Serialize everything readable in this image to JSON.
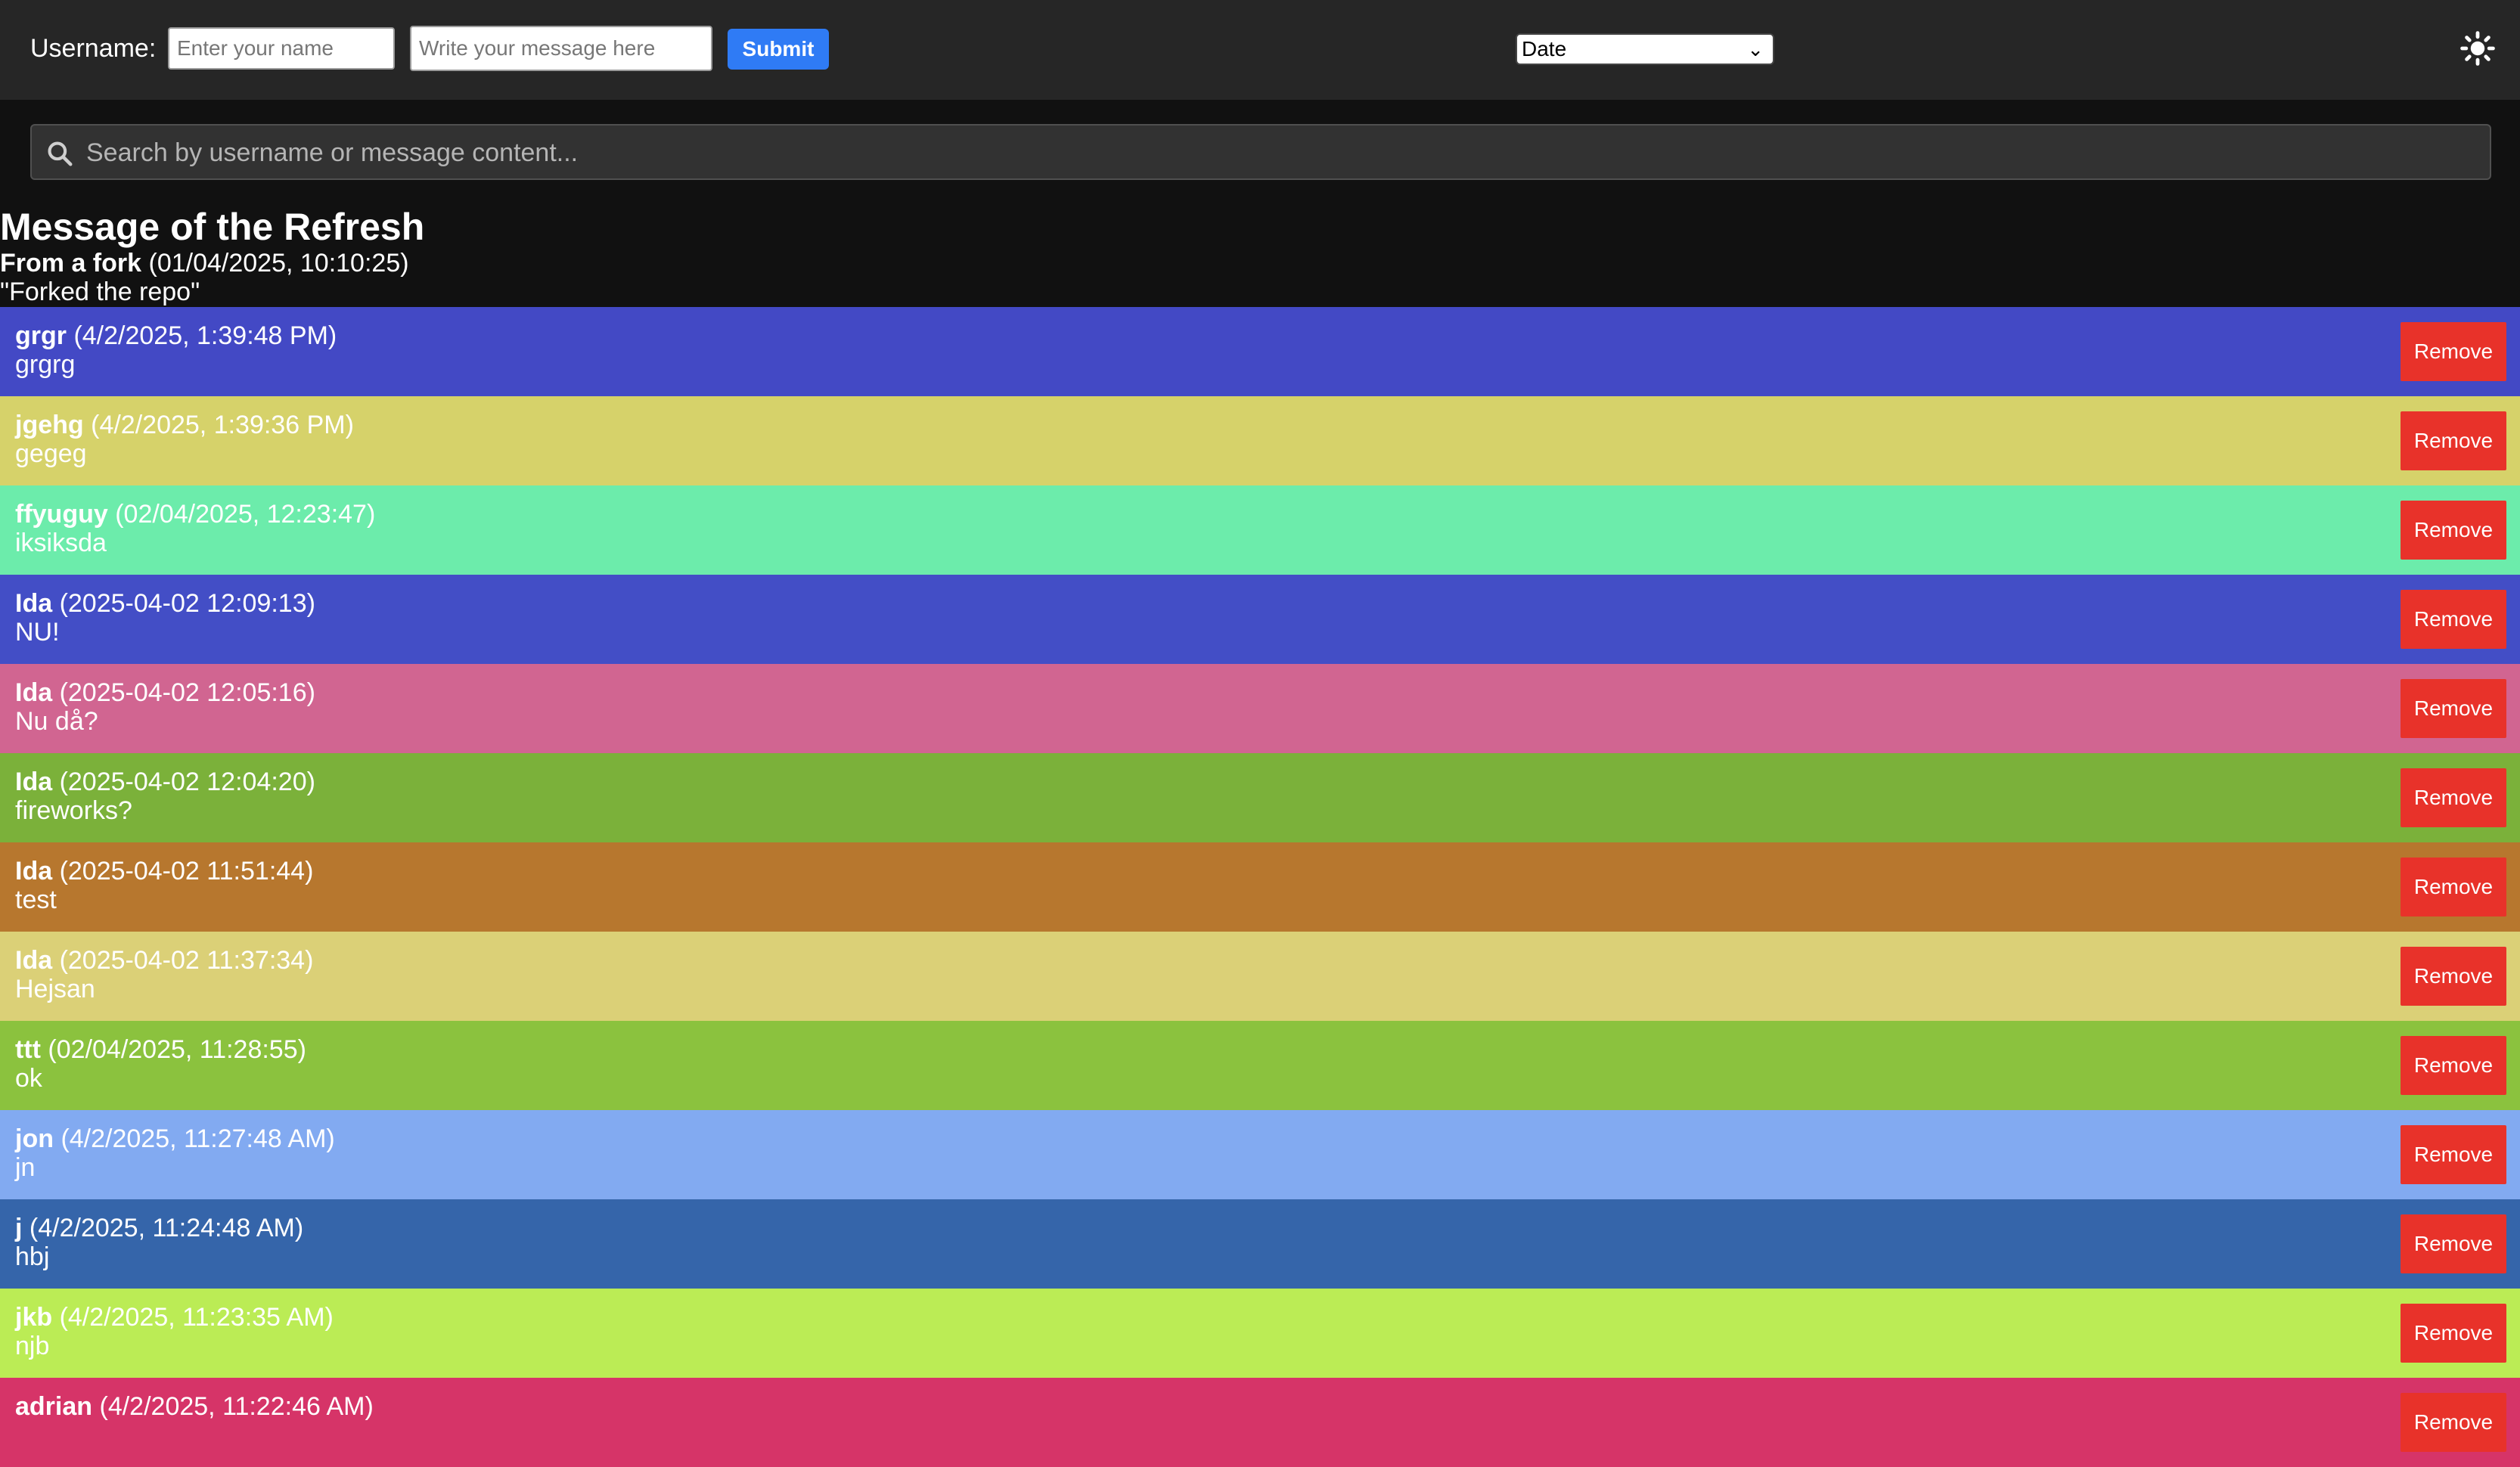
{
  "header": {
    "username_label": "Username:",
    "username_placeholder": "Enter your name",
    "message_placeholder": "Write your message here",
    "submit_label": "Submit",
    "sort_selected": "Date",
    "theme_icon": "sun-icon"
  },
  "search": {
    "placeholder": "Search by username or message content...",
    "icon": "search-icon"
  },
  "message_of_refresh": {
    "title": "Message of the Refresh",
    "author": "From a fork",
    "timestamp": "(01/04/2025, 10:10:25)",
    "text": "\"Forked the repo\""
  },
  "messages": [
    {
      "user": "grgr",
      "time": "(4/2/2025, 1:39:48 PM)",
      "text": "grgrg",
      "color": "#4349c5",
      "remove_label": "Remove"
    },
    {
      "user": "jgehg",
      "time": "(4/2/2025, 1:39:36 PM)",
      "text": "gegeg",
      "color": "#d6d26a",
      "remove_label": "Remove"
    },
    {
      "user": "ffyuguy",
      "time": "(02/04/2025, 12:23:47)",
      "text": "iksiksda",
      "color": "#6cecab",
      "remove_label": "Remove"
    },
    {
      "user": "Ida",
      "time": "(2025-04-02 12:09:13)",
      "text": "NU!",
      "color": "#434ec6",
      "remove_label": "Remove"
    },
    {
      "user": "Ida",
      "time": "(2025-04-02 12:05:16)",
      "text": "Nu då?",
      "color": "#d16591",
      "remove_label": "Remove"
    },
    {
      "user": "Ida",
      "time": "(2025-04-02 12:04:20)",
      "text": "fireworks?",
      "color": "#7bb13a",
      "remove_label": "Remove"
    },
    {
      "user": "Ida",
      "time": "(2025-04-02 11:51:44)",
      "text": "test",
      "color": "#b7772e",
      "remove_label": "Remove"
    },
    {
      "user": "Ida",
      "time": "(2025-04-02 11:37:34)",
      "text": "Hejsan",
      "color": "#dbd077",
      "remove_label": "Remove"
    },
    {
      "user": "ttt",
      "time": "(02/04/2025, 11:28:55)",
      "text": "ok",
      "color": "#8bc23e",
      "remove_label": "Remove"
    },
    {
      "user": "jon",
      "time": "(4/2/2025, 11:27:48 AM)",
      "text": "jn",
      "color": "#82aaf1",
      "remove_label": "Remove"
    },
    {
      "user": "j",
      "time": "(4/2/2025, 11:24:48 AM)",
      "text": "hbj",
      "color": "#3565aa",
      "remove_label": "Remove"
    },
    {
      "user": "jkb",
      "time": "(4/2/2025, 11:23:35 AM)",
      "text": "njb",
      "color": "#bbec55",
      "remove_label": "Remove"
    },
    {
      "user": "adrian",
      "time": "(4/2/2025, 11:22:46 AM)",
      "text": "",
      "color": "#d63468",
      "remove_label": "Remove"
    }
  ]
}
